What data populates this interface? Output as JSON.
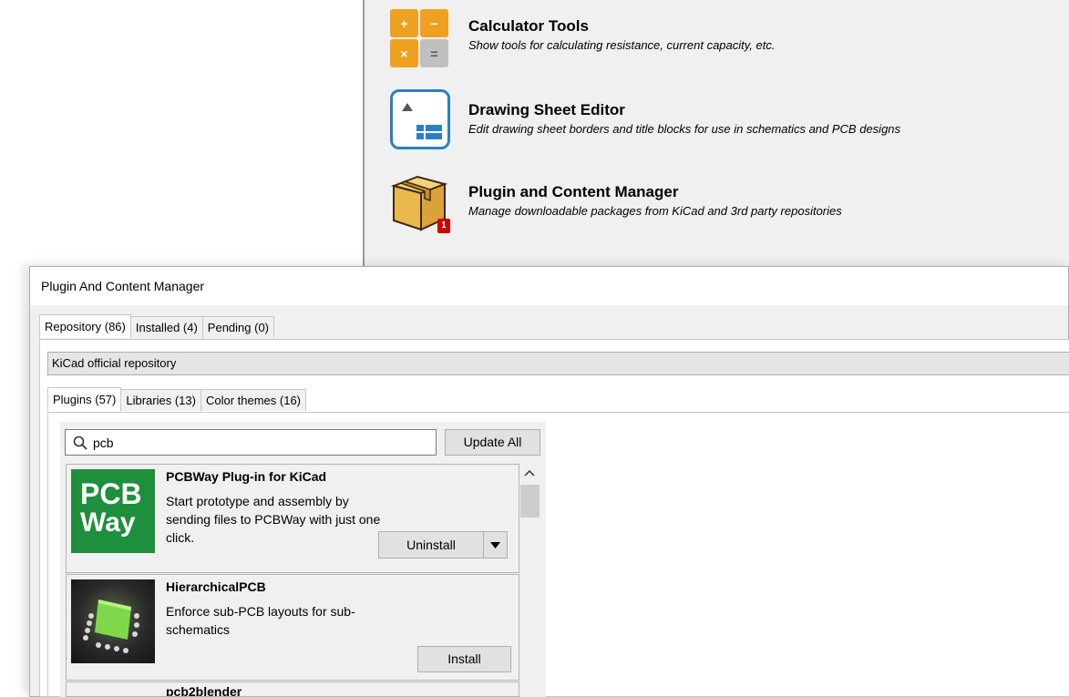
{
  "launcher": {
    "items": [
      {
        "title": "Calculator Tools",
        "description": "Show tools for calculating resistance, current capacity, etc.",
        "icon": "calculator-icon",
        "glyphs": [
          "+",
          "−",
          "×",
          "="
        ]
      },
      {
        "title": "Drawing Sheet Editor",
        "description": "Edit drawing sheet borders and title blocks for use in schematics and PCB designs",
        "icon": "drawing-sheet-icon"
      },
      {
        "title": "Plugin and Content Manager",
        "description": "Manage downloadable packages from KiCad and 3rd party repositories",
        "icon": "package-box-icon",
        "badge": "1"
      }
    ]
  },
  "dialog": {
    "title": "Plugin And Content Manager",
    "tabs": [
      "Repository (86)",
      "Installed (4)",
      "Pending (0)"
    ],
    "repository": "KiCad official repository",
    "subtabs": [
      "Plugins (57)",
      "Libraries (13)",
      "Color themes (16)"
    ],
    "search": {
      "value": "pcb"
    },
    "update_all_label": "Update All",
    "packages": [
      {
        "name": "PCBWay Plug-in for KiCad",
        "description": "Start prototype and assembly by sending files to PCBWay with just one click.",
        "logo_lines": [
          "PCB",
          "Way"
        ],
        "action": "Uninstall"
      },
      {
        "name": "HierarchicalPCB",
        "description": "Enforce sub-PCB layouts for sub-schematics",
        "action": "Install"
      },
      {
        "name": "pcb2blender"
      }
    ]
  },
  "colors": {
    "pcbway_green": "#1e8f3c",
    "accent_blue": "#2a80c8",
    "badge_red": "#d10000",
    "calc_orange": "#f0a020"
  }
}
